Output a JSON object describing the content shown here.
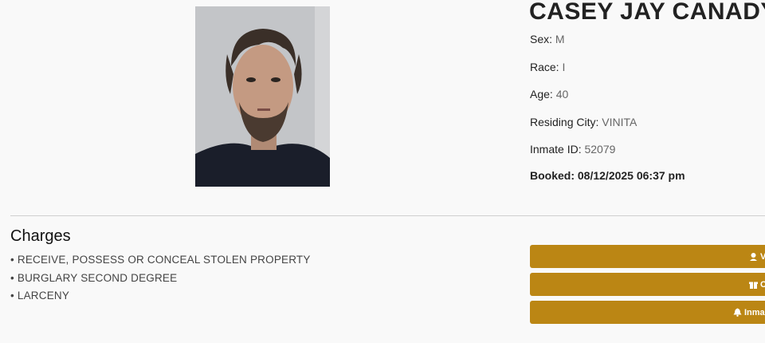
{
  "inmate": {
    "name": "CASEY JAY CANADY",
    "sex_label": "Sex:",
    "sex": "M",
    "race_label": "Race:",
    "race": "I",
    "age_label": "Age:",
    "age": "40",
    "city_label": "Residing City:",
    "city": "VINITA",
    "id_label": "Inmate ID:",
    "id": "52079",
    "booked": "Booked: 08/12/2025 06:37 pm"
  },
  "charges": {
    "title": "Charges",
    "items": [
      "• RECEIVE, POSSESS OR CONCEAL STOLEN PROPERTY",
      "• BURGLARY SECOND DEGREE",
      "• LARCENY"
    ]
  },
  "buttons": [
    {
      "label": "V",
      "icon": "user-secret-icon"
    },
    {
      "label": "C",
      "icon": "gift-icon"
    },
    {
      "label": "Inma",
      "icon": "bell-icon"
    }
  ],
  "colors": {
    "button_bg": "#bb8614",
    "divider": "#cfcfcf"
  }
}
